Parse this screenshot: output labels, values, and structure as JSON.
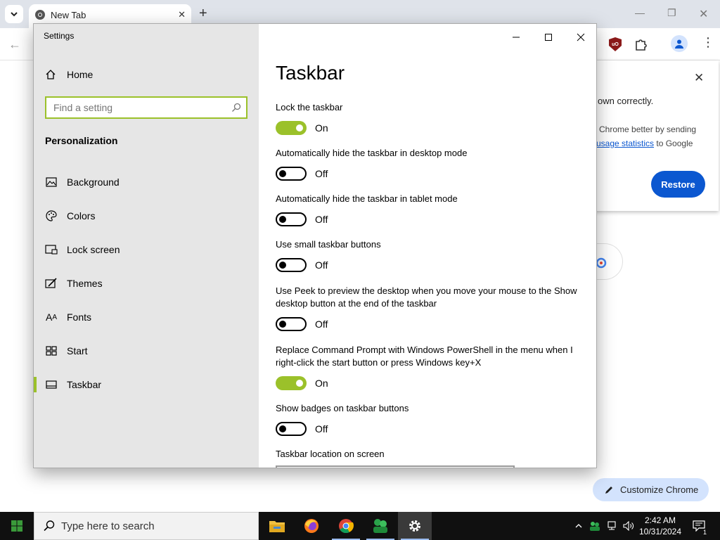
{
  "browser": {
    "tab_title": "New Tab",
    "popup": {
      "line1": "own correctly.",
      "line2": "Chrome better by sending",
      "line3_link": "usage statistics",
      "line3_rest": " to Google",
      "restore_label": "Restore"
    },
    "customize_label": "Customize Chrome"
  },
  "settings": {
    "window_title": "Settings",
    "home_label": "Home",
    "search_placeholder": "Find a setting",
    "section_heading": "Personalization",
    "nav": [
      {
        "label": "Background",
        "icon": "background-image-icon"
      },
      {
        "label": "Colors",
        "icon": "palette-icon"
      },
      {
        "label": "Lock screen",
        "icon": "lock-screen-icon"
      },
      {
        "label": "Themes",
        "icon": "themes-brush-icon"
      },
      {
        "label": "Fonts",
        "icon": "fonts-icon"
      },
      {
        "label": "Start",
        "icon": "start-grid-icon"
      },
      {
        "label": "Taskbar",
        "icon": "taskbar-icon",
        "active": true
      }
    ],
    "page_title": "Taskbar",
    "options": [
      {
        "label": "Lock the taskbar",
        "state": "On"
      },
      {
        "label": "Automatically hide the taskbar in desktop mode",
        "state": "Off"
      },
      {
        "label": "Automatically hide the taskbar in tablet mode",
        "state": "Off"
      },
      {
        "label": "Use small taskbar buttons",
        "state": "Off"
      },
      {
        "label": "Use Peek to preview the desktop when you move your mouse to the Show desktop button at the end of the taskbar",
        "state": "Off"
      },
      {
        "label": "Replace Command Prompt with Windows PowerShell in the menu when I right-click the start button or press Windows key+X",
        "state": "On"
      },
      {
        "label": "Show badges on taskbar buttons",
        "state": "Off"
      }
    ],
    "location_label": "Taskbar location on screen",
    "accent_color": "#9bc12a"
  },
  "taskbar": {
    "search_placeholder": "Type here to search",
    "apps": [
      "file-explorer-icon",
      "firefox-icon",
      "chrome-icon",
      "green-app-icon",
      "settings-gear-icon"
    ],
    "time": "2:42 AM",
    "date": "10/31/2024",
    "notification_count": "1"
  }
}
